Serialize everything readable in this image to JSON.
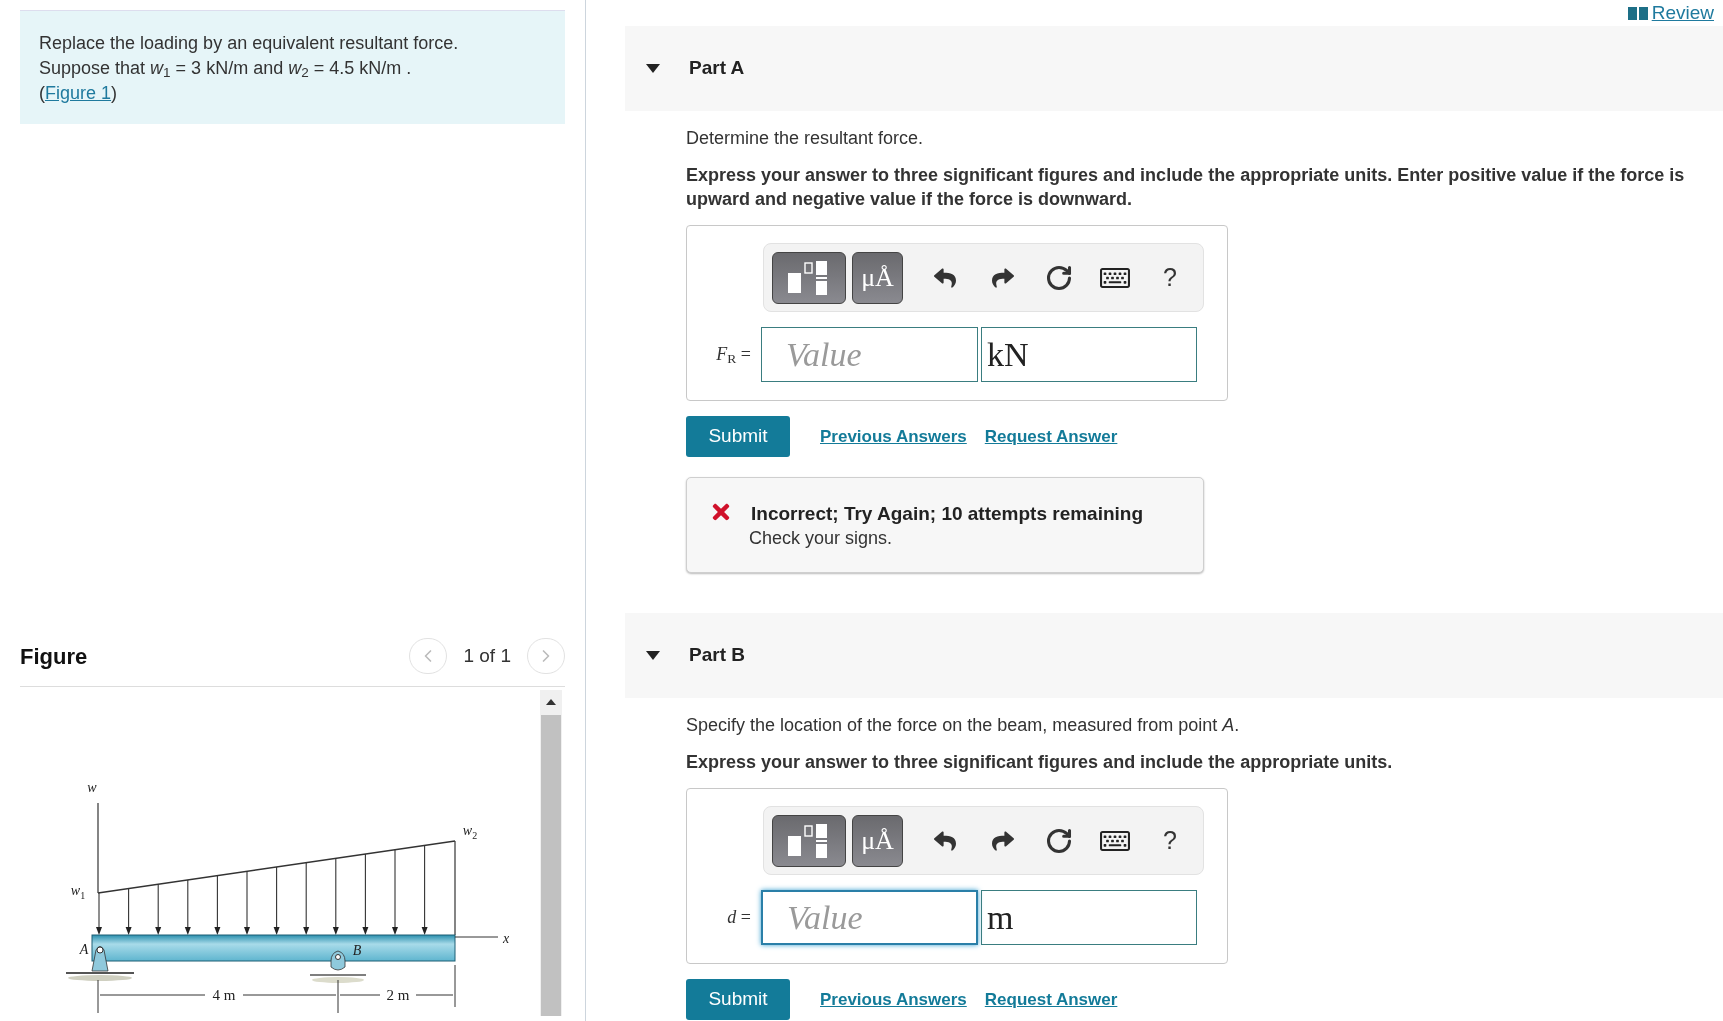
{
  "review_link": "Review",
  "problem": {
    "sentence": "Replace the loading by an equivalent resultant force.",
    "condition": "Suppose that *w*$_{1}$ = 3  kN/m and *w*$_{2}$ = 4.5  kN/m .",
    "link_open": "(",
    "figure_link": "Figure 1",
    "link_close": ")"
  },
  "figure": {
    "title": "Figure",
    "pager": "1 of 1",
    "labels": [
      "*w*",
      "*w*$_{1}$",
      "*w*$_{2}$",
      "*x*",
      "*A*",
      "*B*",
      "4 m",
      "2 m"
    ]
  },
  "parts": [
    {
      "title": "Part A",
      "expanded": true,
      "prompt": "Determine the resultant force.",
      "instructions": "Express your answer to three significant figures and include the appropriate units. Enter positive value if the force is upward and negative value if the force is downward.",
      "symbols_label": "μÅ",
      "help_label": "?",
      "variable": "*F*$_{R}$ =",
      "placeholder": "Value",
      "unit": "kN",
      "focused": false,
      "submit": "Submit",
      "previous": "Previous Answers",
      "request": "Request Answer",
      "feedback": {
        "kind": "incorrect",
        "heading": "Incorrect; Try Again; 10 attempts remaining",
        "message": "Check your signs."
      }
    },
    {
      "title": "Part B",
      "expanded": true,
      "prompt": "Specify the location of the force on the beam, measured from point *A*.",
      "instructions": "Express your answer to three significant figures and include the appropriate units.",
      "symbols_label": "μÅ",
      "help_label": "?",
      "variable": "*d* =",
      "placeholder": "Value",
      "unit": "m",
      "focused": true,
      "submit": "Submit",
      "previous": "Previous Answers",
      "request": "Request Answer"
    }
  ]
}
